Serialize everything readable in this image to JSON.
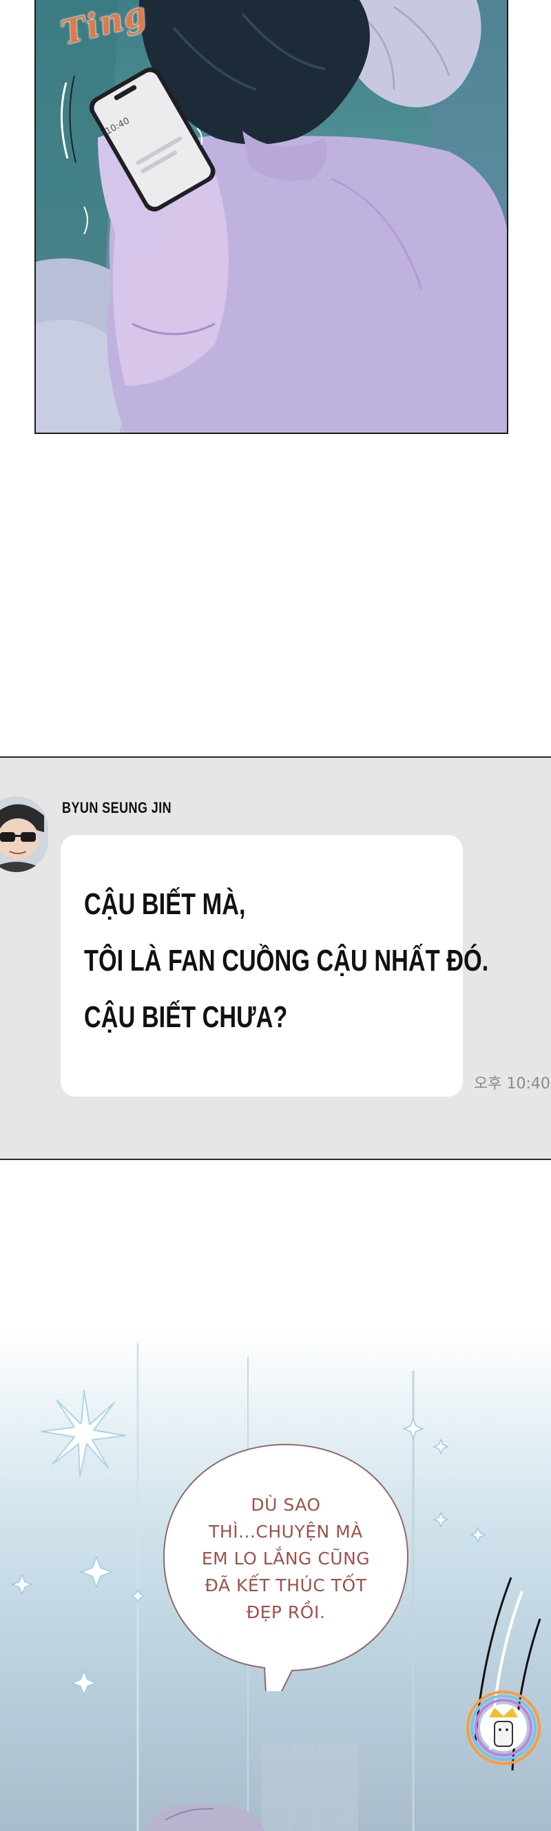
{
  "panel1": {
    "sound_effect": "Ting",
    "phone_time": "10:40"
  },
  "chat": {
    "sender_name": "BYUN SEUNG JIN",
    "message_lines": [
      "CẬU BIẾT MÀ,",
      "TÔI LÀ FAN CUỒNG CẬU NHẤT ĐÓ.",
      "CẬU BIẾT CHƯA?"
    ],
    "timestamp": "오후 10:40",
    "background_color": "#e6e6e6",
    "bubble_color": "#ffffff"
  },
  "panel3": {
    "speech_lines": [
      "DÙ SAO",
      "THÌ...CHUYỆN MÀ",
      "EM LO LẮNG CŨNG",
      "ĐÃ KẾT THÚC TỐT",
      "ĐẸP RỒI."
    ],
    "speech_color": "#a0504a",
    "watermark_icon": "crown-logo-icon"
  }
}
